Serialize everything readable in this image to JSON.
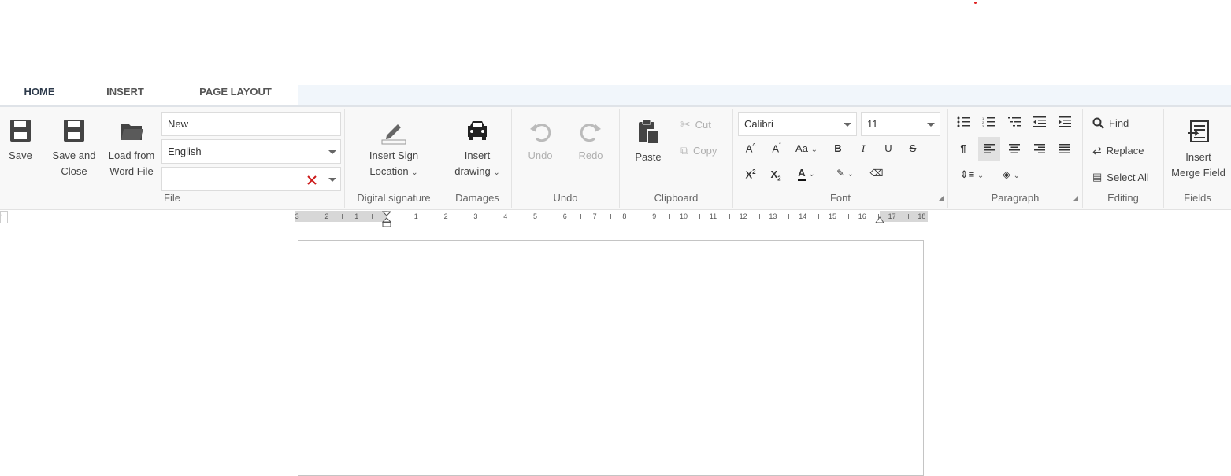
{
  "tabs": [
    {
      "label": "HOME",
      "active": true
    },
    {
      "label": "INSERT",
      "active": false
    },
    {
      "label": "PAGE LAYOUT",
      "active": false
    }
  ],
  "file": {
    "save": "Save",
    "save_close": [
      "Save and",
      "Close"
    ],
    "load": [
      "Load from",
      "Word File"
    ],
    "name_value": "New",
    "language_value": "English",
    "template_value": "",
    "group": "File"
  },
  "digital_signature": {
    "insert": [
      "Insert Sign",
      "Location"
    ],
    "group": "Digital signature"
  },
  "damages": {
    "insert": [
      "Insert",
      "drawing"
    ],
    "group": "Damages"
  },
  "undo": {
    "undo": "Undo",
    "redo": "Redo",
    "group": "Undo"
  },
  "clipboard": {
    "paste": "Paste",
    "cut": "Cut",
    "copy": "Copy",
    "group": "Clipboard"
  },
  "font": {
    "family": "Calibri",
    "size": "11",
    "group": "Font"
  },
  "paragraph": {
    "group": "Paragraph"
  },
  "editing": {
    "find": "Find",
    "replace": "Replace",
    "select_all": "Select All",
    "group": "Editing"
  },
  "fields": {
    "insert": [
      "Insert",
      "Merge Field"
    ],
    "group": "Fields"
  },
  "ruler": {
    "left_numbers": [
      "3",
      "2",
      "1"
    ],
    "right_numbers": [
      "1",
      "2",
      "3",
      "4",
      "5",
      "6",
      "7",
      "8",
      "9",
      "10",
      "11",
      "12",
      "13",
      "14",
      "15",
      "16",
      "17",
      "18"
    ]
  },
  "colors": {
    "accent": "#5aa7d8",
    "tab_bg": "#f1f6fb",
    "ribbon_bg": "#f8f8f8",
    "clear_x": "#cc1b1b"
  }
}
